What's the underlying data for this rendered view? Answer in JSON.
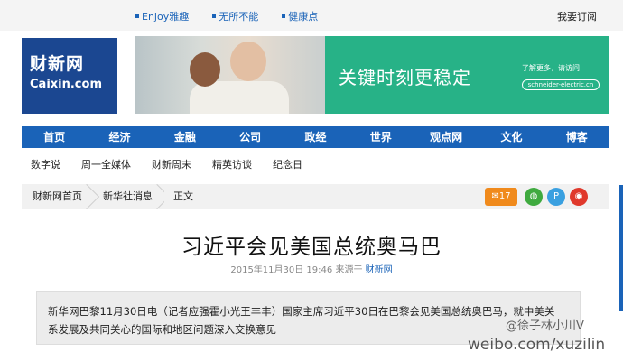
{
  "top_links": [
    "Enjoy雅趣",
    "无所不能",
    "健康点"
  ],
  "subscribe": "我要订阅",
  "logo": {
    "zh": "财新网",
    "en": "Caixin.com"
  },
  "banner": {
    "headline": "关键时刻更稳定",
    "cta": "了解更多，请访问",
    "url": "schneider-electric.cn"
  },
  "main_nav": [
    "首页",
    "经济",
    "金融",
    "公司",
    "政经",
    "世界",
    "观点网",
    "文化",
    "博客"
  ],
  "sub_nav": [
    "数字说",
    "周一全媒体",
    "财新周末",
    "精英访谈",
    "纪念日"
  ],
  "breadcrumb": [
    "财新网首页",
    "新华社消息",
    "正文"
  ],
  "share": {
    "comment_count": "17"
  },
  "article": {
    "title": "习近平会见美国总统奥马巴",
    "date": "2015年11月30日 19:46",
    "source_label": "来源于",
    "source": "财新网",
    "summary": "新华网巴黎11月30日电（记者应强霍小光王丰丰）国家主席习近平30日在巴黎会见美国总统奥巴马，就中美关系发展及共同关心的国际和地区问题深入交换意见"
  },
  "watermark": {
    "line1": "@徐子林小川V",
    "line2": "weibo.com/xuzilin"
  },
  "colors": {
    "nav_blue": "#1a63b8",
    "logo_blue": "#1b4791",
    "banner_green": "#27b287"
  }
}
